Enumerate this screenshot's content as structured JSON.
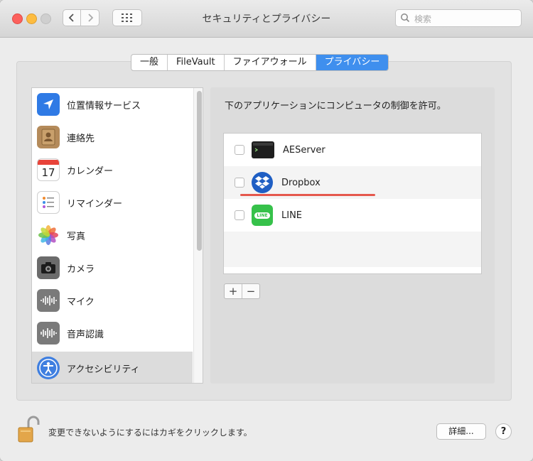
{
  "window": {
    "title": "セキュリティとプライバシー"
  },
  "search": {
    "placeholder": "検索"
  },
  "tabs": [
    {
      "label": "一般",
      "active": false
    },
    {
      "label": "FileVault",
      "active": false
    },
    {
      "label": "ファイアウォール",
      "active": false
    },
    {
      "label": "プライバシー",
      "active": true
    }
  ],
  "sidebar": {
    "items": [
      {
        "label": "位置情報サービス",
        "icon": "location-icon",
        "selected": false
      },
      {
        "label": "連絡先",
        "icon": "contacts-icon",
        "selected": false
      },
      {
        "label": "カレンダー",
        "icon": "calendar-icon",
        "selected": false,
        "icon_text": "17"
      },
      {
        "label": "リマインダー",
        "icon": "reminders-icon",
        "selected": false
      },
      {
        "label": "写真",
        "icon": "photos-icon",
        "selected": false
      },
      {
        "label": "カメラ",
        "icon": "camera-icon",
        "selected": false
      },
      {
        "label": "マイク",
        "icon": "microphone-icon",
        "selected": false
      },
      {
        "label": "音声認識",
        "icon": "speech-recognition-icon",
        "selected": false
      },
      {
        "label": "アクセシビリティ",
        "icon": "accessibility-icon",
        "selected": true
      }
    ]
  },
  "main": {
    "description": "下のアプリケーションにコンピュータの制御を許可。",
    "apps": [
      {
        "name": "AEServer",
        "icon": "terminal-icon",
        "checked": false
      },
      {
        "name": "Dropbox",
        "icon": "dropbox-icon",
        "checked": false
      },
      {
        "name": "LINE",
        "icon": "line-icon",
        "checked": false,
        "icon_text": "LINE"
      }
    ],
    "add_label": "+",
    "remove_label": "−"
  },
  "footer": {
    "lock_text": "変更できないようにするにはカギをクリックします。",
    "advanced_label": "詳細...",
    "help_label": "?"
  },
  "colors": {
    "accent": "#3f8fee",
    "annotation_underline": "#e23c2f"
  }
}
